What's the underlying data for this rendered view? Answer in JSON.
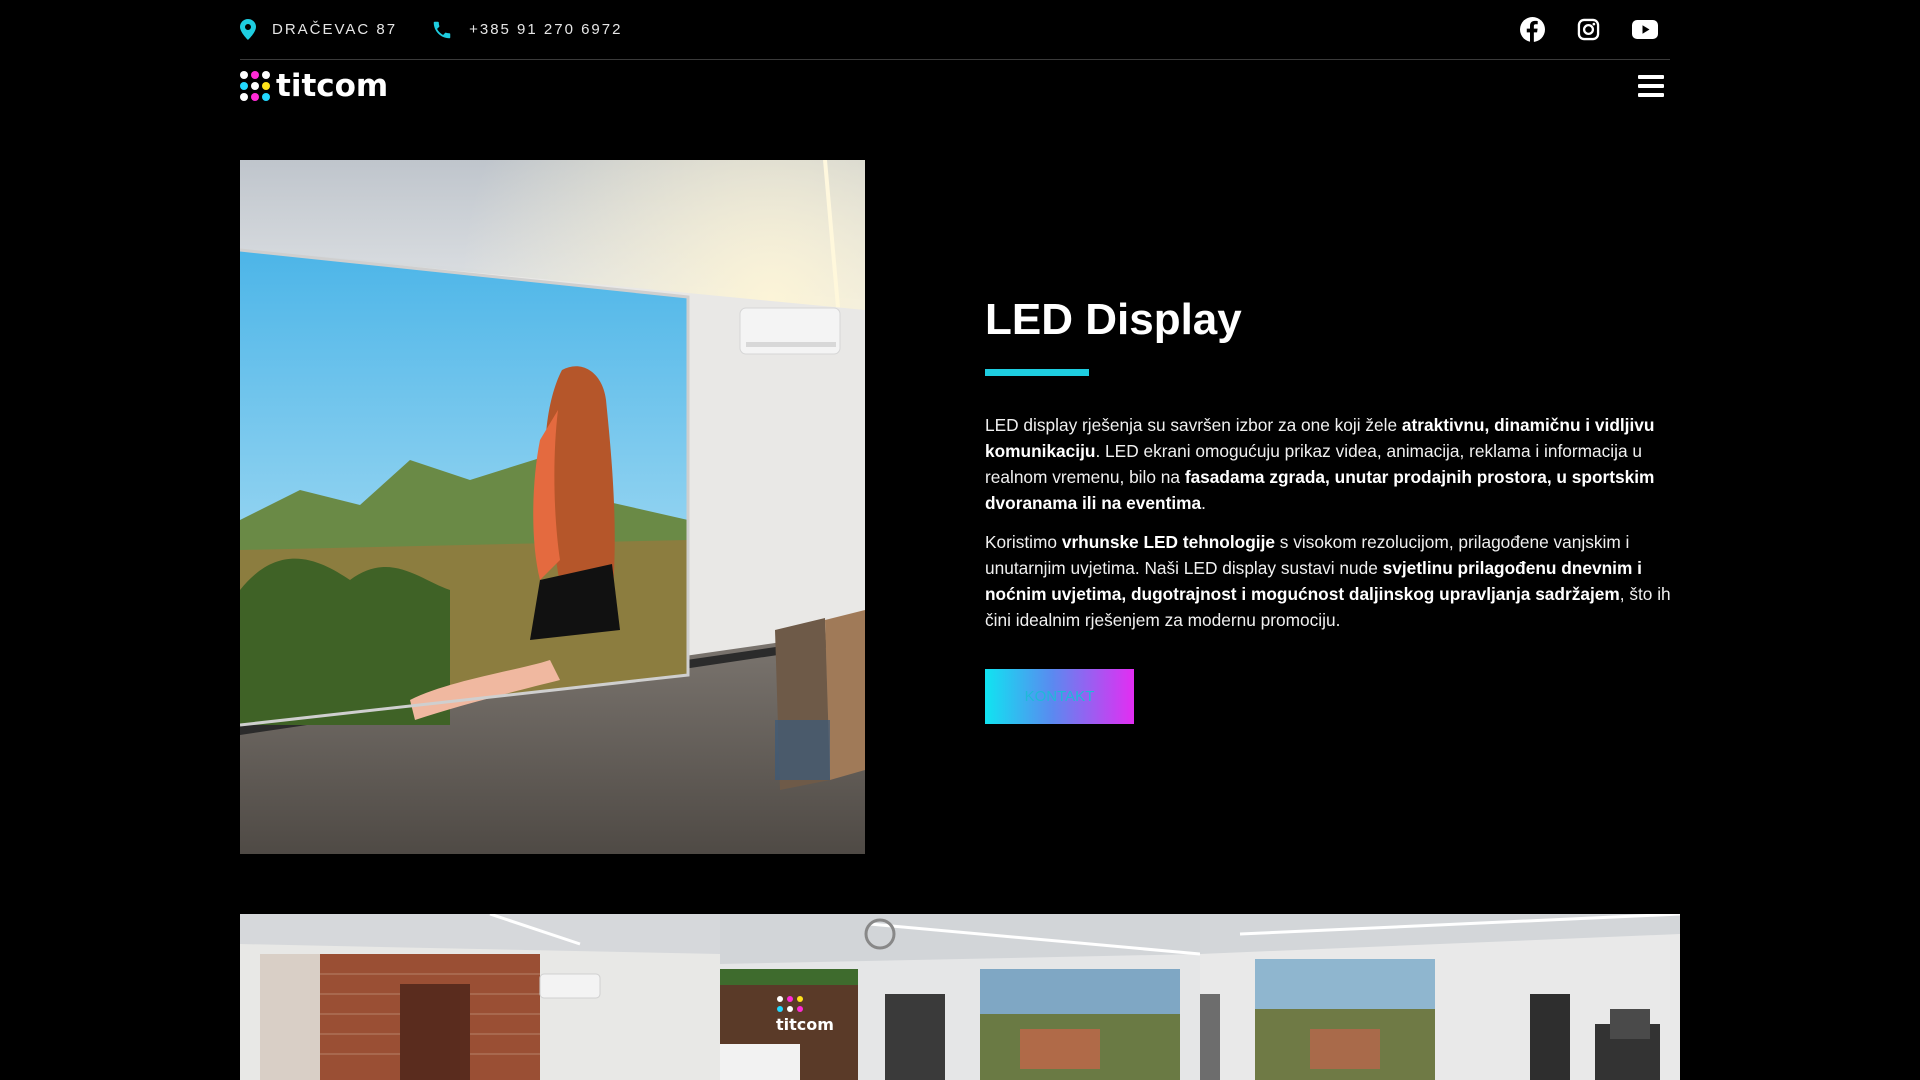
{
  "topbar": {
    "address": "DRAČEVAC 87",
    "phone": "+385 91 270 6972",
    "icons": [
      "location-pin-icon",
      "phone-icon",
      "facebook-icon",
      "instagram-icon",
      "youtube-icon"
    ]
  },
  "brand": {
    "name": "titcom",
    "dot_colors": [
      "#ffffff",
      "#ff2bd6",
      "#ffffff",
      "#22d8ff",
      "#ffffff",
      "#ffe21a",
      "#ffffff",
      "#ff2bd6",
      "#22d8ff"
    ]
  },
  "hero": {
    "title": "LED Display",
    "accent_color": "#1ecde0",
    "paragraph1": [
      {
        "text": "LED display rješenja su savršen izbor za one koji žele ",
        "bold": false
      },
      {
        "text": "atraktivnu, dinamičnu i vidljivu komunikaciju",
        "bold": true
      },
      {
        "text": ". LED ekrani omogućuju prikaz videa, animacija, reklama i informacija u realnom vremenu, bilo na ",
        "bold": false
      },
      {
        "text": "fasadama zgrada, unutar prodajnih prostora, u sportskim dvoranama ili na eventima",
        "bold": true
      },
      {
        "text": ".",
        "bold": false
      }
    ],
    "paragraph2": [
      {
        "text": "Koristimo ",
        "bold": false
      },
      {
        "text": "vrhunske LED tehnologije",
        "bold": true
      },
      {
        "text": " s visokom rezolucijom, prilagođene vanjskim i unutarnjim uvjetima. Naši LED display sustavi nude ",
        "bold": false
      },
      {
        "text": "svjetlinu prilagođenu dnevnim i noćnim uvjetima, dugotrajnost i mogućnost daljinskog upravljanja sadržajem",
        "bold": true
      },
      {
        "text": ", što ih čini idealnim rješenjem za modernu promociju.",
        "bold": false
      }
    ],
    "button_label": "KONTAKT"
  },
  "gallery": {
    "wall_logo": "titcom"
  }
}
